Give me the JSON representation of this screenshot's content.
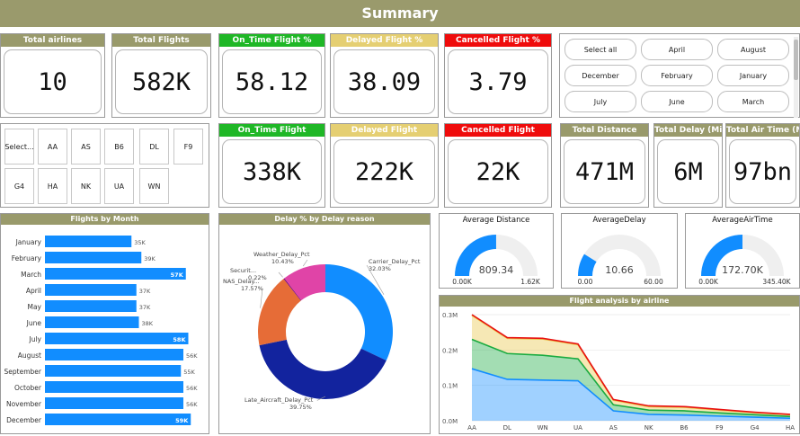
{
  "title": "Summary",
  "kpis": {
    "total_airlines": {
      "label": "Total airlines",
      "value": "10"
    },
    "total_flights": {
      "label": "Total Flights",
      "value": "582K"
    },
    "on_time_pct": {
      "label": "On_Time Flight %",
      "value": "58.12"
    },
    "delayed_pct": {
      "label": "Delayed Flight %",
      "value": "38.09"
    },
    "cancelled_pct": {
      "label": "Cancelled Flight %",
      "value": "3.79"
    },
    "on_time": {
      "label": "On_Time Flight",
      "value": "338K"
    },
    "delayed": {
      "label": "Delayed Flight",
      "value": "222K"
    },
    "cancelled": {
      "label": "Cancelled Flight",
      "value": "22K"
    },
    "total_distance": {
      "label": "Total Distance",
      "value": "471M"
    },
    "total_delay": {
      "label": "Total Delay (Mins)",
      "value": "6M"
    },
    "total_air_time": {
      "label": "Total Air Time (Mins)",
      "value": "97bn"
    }
  },
  "month_slicer": [
    "Select all",
    "April",
    "August",
    "December",
    "February",
    "January",
    "July",
    "June",
    "March"
  ],
  "airline_slicer": [
    "Select...",
    "AA",
    "AS",
    "B6",
    "DL",
    "F9",
    "G4",
    "HA",
    "NK",
    "UA",
    "WN"
  ],
  "flights_by_month": {
    "title": "Flights by Month",
    "categories": [
      "January",
      "February",
      "March",
      "April",
      "May",
      "June",
      "July",
      "August",
      "September",
      "October",
      "November",
      "December"
    ],
    "values": [
      35,
      39,
      57,
      37,
      37,
      38,
      58,
      56,
      55,
      56,
      56,
      59
    ],
    "labels": [
      "35K",
      "39K",
      "57K",
      "37K",
      "37K",
      "38K",
      "58K",
      "56K",
      "55K",
      "56K",
      "56K",
      "59K"
    ],
    "color": "#118dff"
  },
  "delay_reason": {
    "title": "Delay % by Delay reason",
    "slices": [
      {
        "name": "Carrier_Delay_Pct",
        "value": 32.03,
        "label": "32.03%",
        "color": "#118dff"
      },
      {
        "name": "Late_Aircraft_Delay_Pct",
        "value": 39.75,
        "label": "39.75%",
        "color": "#12239e"
      },
      {
        "name": "NAS_Delay...",
        "value": 17.57,
        "label": "17.57%",
        "color": "#e66c37"
      },
      {
        "name": "Securit...",
        "value": 0.22,
        "label": "0.22%",
        "color": "#6b007b"
      },
      {
        "name": "Weather_Delay_Pct",
        "value": 10.43,
        "label": "10.43%",
        "color": "#e044a7"
      }
    ]
  },
  "gauges": [
    {
      "title": "Average Distance",
      "value": 809.34,
      "min": 0,
      "max": 1620,
      "value_label": "809.34",
      "min_label": "0.00K",
      "max_label": "1.62K"
    },
    {
      "title": "AverageDelay",
      "value": 10.66,
      "min": 0,
      "max": 60,
      "value_label": "10.66",
      "min_label": "0.00",
      "max_label": "60.00"
    },
    {
      "title": "AverageAirTime",
      "value": 172.7,
      "min": 0,
      "max": 345.4,
      "value_label": "172.70K",
      "min_label": "0.00K",
      "max_label": "345.40K"
    }
  ],
  "gauge_colors": {
    "fill": "#118dff",
    "track": "#efefef"
  },
  "chart_data": {
    "type": "area",
    "title": "Flight analysis by airline",
    "categories": [
      "AA",
      "DL",
      "WN",
      "UA",
      "AS",
      "NK",
      "B6",
      "F9",
      "G4",
      "HA"
    ],
    "ylim": [
      0,
      300000
    ],
    "yticks": [
      "0.0M",
      "0.1M",
      "0.2M",
      "0.3M"
    ],
    "series": [
      {
        "color": "#118dff",
        "values": [
          147000,
          117000,
          115000,
          113000,
          28000,
          18000,
          16000,
          13000,
          10000,
          7000
        ]
      },
      {
        "color": "#1aab40",
        "values": [
          230000,
          190000,
          185000,
          175000,
          45000,
          30000,
          28000,
          22000,
          17000,
          12000
        ]
      },
      {
        "color": "#e8c547",
        "values": [
          298000,
          233000,
          231000,
          215000,
          58000,
          40000,
          38000,
          30000,
          23000,
          17000
        ]
      },
      {
        "color": "#e81010",
        "values": [
          300000,
          235000,
          233000,
          217000,
          60000,
          42000,
          40000,
          32000,
          24000,
          18000
        ]
      }
    ]
  }
}
